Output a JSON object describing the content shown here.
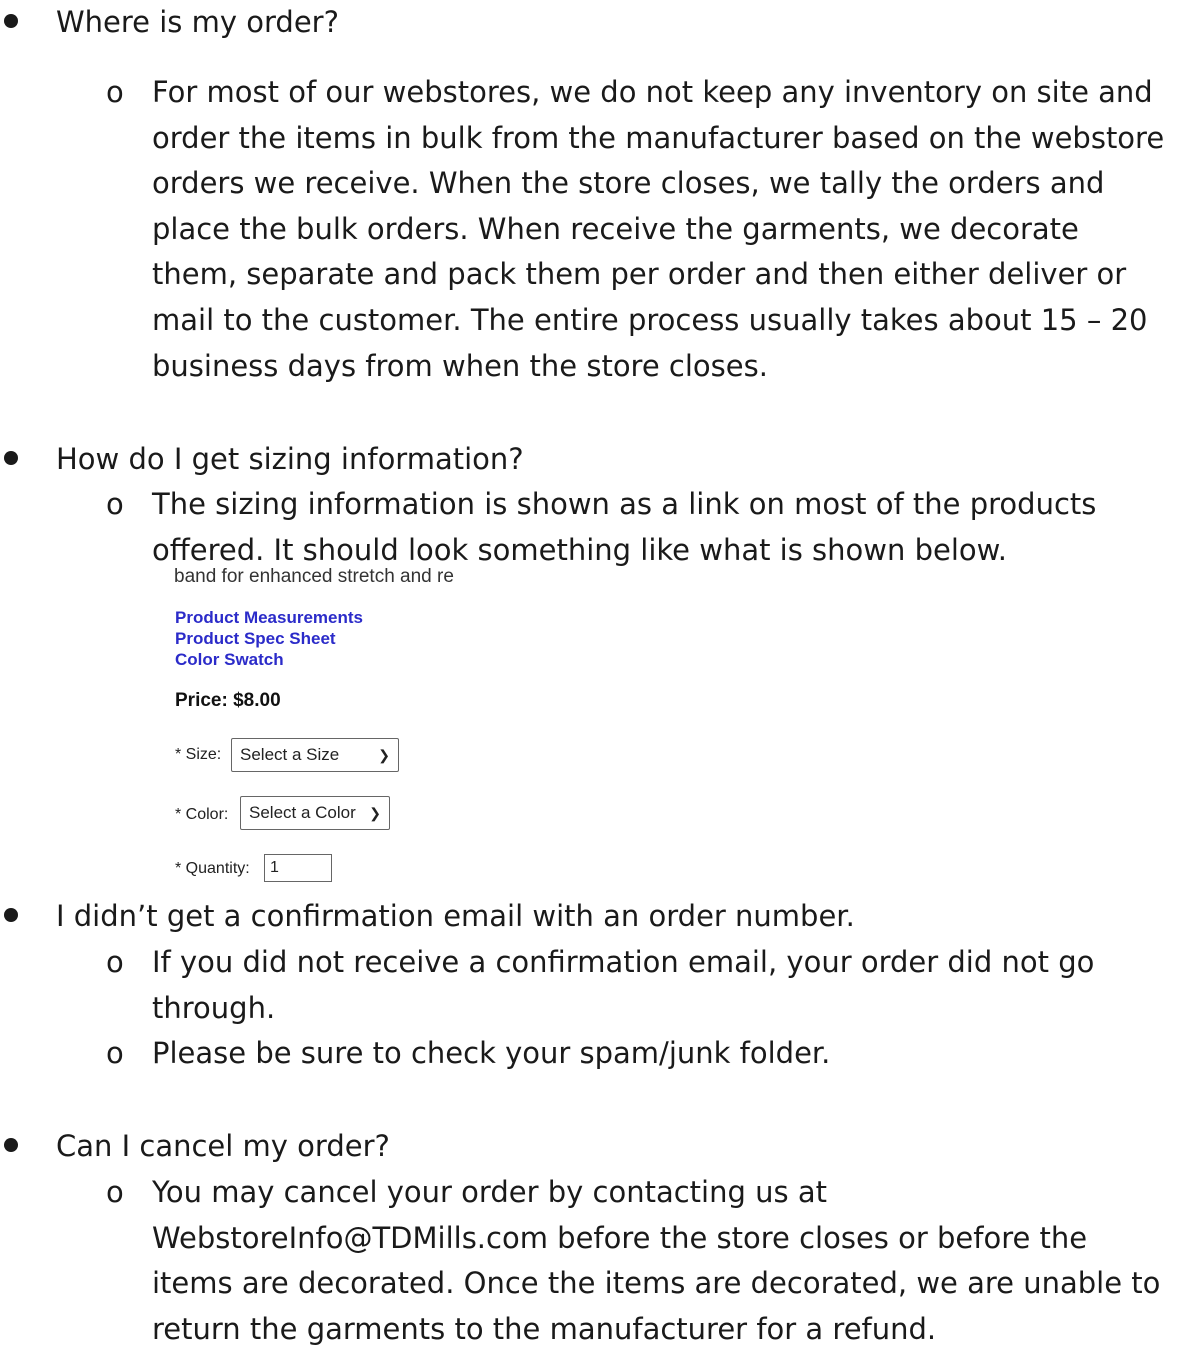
{
  "faq": [
    {
      "question": "Where is my order?",
      "answer_lines": [
        "For most of our webstores, we do not keep any inventory on site and",
        "order the items in bulk from the manufacturer based on the webstore",
        "orders we receive.  When the store closes, we tally the orders and",
        "place the bulk orders.    When receive the garments, we decorate",
        "them, separate and pack them per order and then either deliver or",
        "mail to the customer.    The entire process usually takes about 15 – 20",
        "business days from when the store closes."
      ]
    },
    {
      "question": "How do I get sizing information?",
      "answer_lines": [
        "The sizing information is shown as a link on most of the products",
        "offered.  It should look something like what is shown below."
      ]
    },
    {
      "question": "I didn’t get a confirmation email with an order number.",
      "answer_1_lines": [
        "If you did not receive a confirmation email, your order did not go",
        "through."
      ],
      "answer_2_lines": [
        "Please be sure to check your spam/junk folder."
      ]
    },
    {
      "question": "Can I cancel my order?",
      "answer_lines": [
        "You may cancel your order by contacting us at",
        "WebstoreInfo@TDMills.com before the store closes or before the",
        "items are decorated.  Once the items are decorated, we are unable to",
        "return the garments to the manufacturer for a refund."
      ]
    }
  ],
  "product_screenshot": {
    "cut_text": "band for enhanced stretch and re",
    "links": [
      "Product Measurements",
      "Product Spec Sheet",
      "Color Swatch"
    ],
    "price": "Price: $8.00",
    "size_label": "* Size:",
    "size_value": "Select a Size",
    "color_label": "* Color:",
    "color_value": "Select a Color",
    "quantity_label": "* Quantity:",
    "quantity_value": "1"
  }
}
